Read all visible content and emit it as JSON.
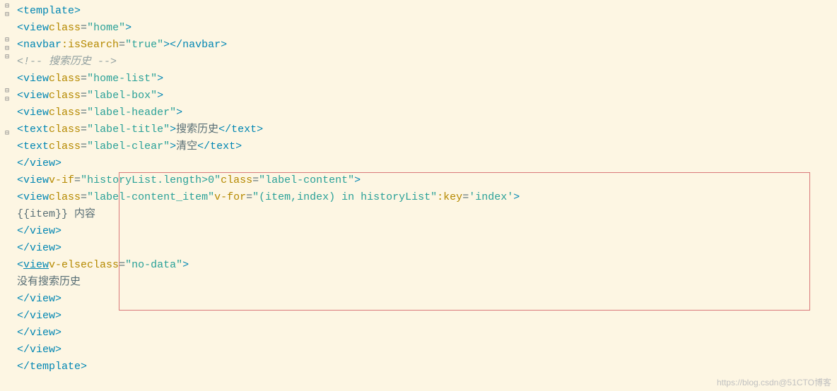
{
  "gutter": {
    "icons": [
      "⊟",
      "⊟",
      "",
      "",
      "⊟",
      "⊟",
      "⊟",
      "",
      "",
      "",
      "⊟",
      "⊟",
      "",
      "",
      "",
      "⊟",
      "",
      "",
      "",
      "",
      "",
      ""
    ]
  },
  "code": {
    "lines": [
      {
        "indent": 0,
        "parts": [
          {
            "t": "open",
            "name": "template"
          }
        ]
      },
      {
        "indent": 1,
        "parts": [
          {
            "t": "open",
            "name": "view",
            "attrs": [
              {
                "n": "class",
                "v": "\"home\""
              }
            ]
          }
        ]
      },
      {
        "indent": 2,
        "parts": [
          {
            "t": "open",
            "name": "navbar",
            "attrs": [
              {
                "n": ":isSearch",
                "v": "\"true\""
              }
            ]
          },
          {
            "t": "close",
            "name": "navbar"
          }
        ]
      },
      {
        "indent": 2,
        "parts": [
          {
            "t": "comment",
            "text": "<!-- 搜索历史 -->"
          }
        ]
      },
      {
        "indent": 2,
        "parts": [
          {
            "t": "open",
            "name": "view",
            "attrs": [
              {
                "n": "class",
                "v": "\"home-list\""
              }
            ]
          }
        ]
      },
      {
        "indent": 3,
        "parts": [
          {
            "t": "open",
            "name": "view",
            "attrs": [
              {
                "n": "class",
                "v": "\"label-box\""
              }
            ]
          }
        ]
      },
      {
        "indent": 4,
        "parts": [
          {
            "t": "open",
            "name": "view",
            "attrs": [
              {
                "n": "class",
                "v": "\"label-header\""
              }
            ]
          }
        ]
      },
      {
        "indent": 5,
        "parts": [
          {
            "t": "open",
            "name": "text",
            "attrs": [
              {
                "n": "class",
                "v": "\"label-title\""
              }
            ]
          },
          {
            "t": "text",
            "text": "搜索历史"
          },
          {
            "t": "close",
            "name": "text"
          }
        ]
      },
      {
        "indent": 5,
        "parts": [
          {
            "t": "open",
            "name": "text",
            "attrs": [
              {
                "n": "class",
                "v": "\"label-clear\""
              }
            ]
          },
          {
            "t": "text",
            "text": "清空"
          },
          {
            "t": "close",
            "name": "text"
          }
        ]
      },
      {
        "indent": 4,
        "parts": [
          {
            "t": "close",
            "name": "view"
          }
        ]
      },
      {
        "indent": 4,
        "parts": [
          {
            "t": "open",
            "name": "view",
            "attrs": [
              {
                "n": "v-if",
                "v": "\"historyList.length>0\""
              },
              {
                "n": "class",
                "v": "\"label-content\""
              }
            ]
          }
        ]
      },
      {
        "indent": 5,
        "parts": [
          {
            "t": "open",
            "name": "view",
            "attrs": [
              {
                "n": "class",
                "v": "\"label-content_item\""
              },
              {
                "n": "v-for",
                "v": "\"(item,index) in historyList\""
              },
              {
                "n": ":key",
                "v": "'index'"
              }
            ]
          }
        ]
      },
      {
        "indent": 6,
        "parts": [
          {
            "t": "text",
            "text": "{{item}} 内容"
          }
        ]
      },
      {
        "indent": 5,
        "parts": [
          {
            "t": "close",
            "name": "view"
          }
        ]
      },
      {
        "indent": 4,
        "parts": [
          {
            "t": "close",
            "name": "view"
          }
        ]
      },
      {
        "indent": 4,
        "parts": [
          {
            "t": "open",
            "name": "view",
            "underline": true,
            "attrs": [
              {
                "n": "v-else",
                "novalue": true
              },
              {
                "n": "class",
                "v": "\"no-data\""
              }
            ]
          }
        ]
      },
      {
        "indent": 5,
        "parts": [
          {
            "t": "text",
            "text": "没有搜索历史"
          }
        ]
      },
      {
        "indent": 4,
        "parts": [
          {
            "t": "close",
            "name": "view"
          }
        ]
      },
      {
        "indent": 3,
        "parts": [
          {
            "t": "close",
            "name": "view"
          }
        ]
      },
      {
        "indent": 2,
        "parts": [
          {
            "t": "close",
            "name": "view"
          }
        ]
      },
      {
        "indent": 1,
        "parts": [
          {
            "t": "close",
            "name": "view"
          }
        ]
      },
      {
        "indent": 0,
        "parts": [
          {
            "t": "close",
            "name": "template"
          }
        ]
      }
    ]
  },
  "watermark": "https://blog.csdn@51CTO博客"
}
